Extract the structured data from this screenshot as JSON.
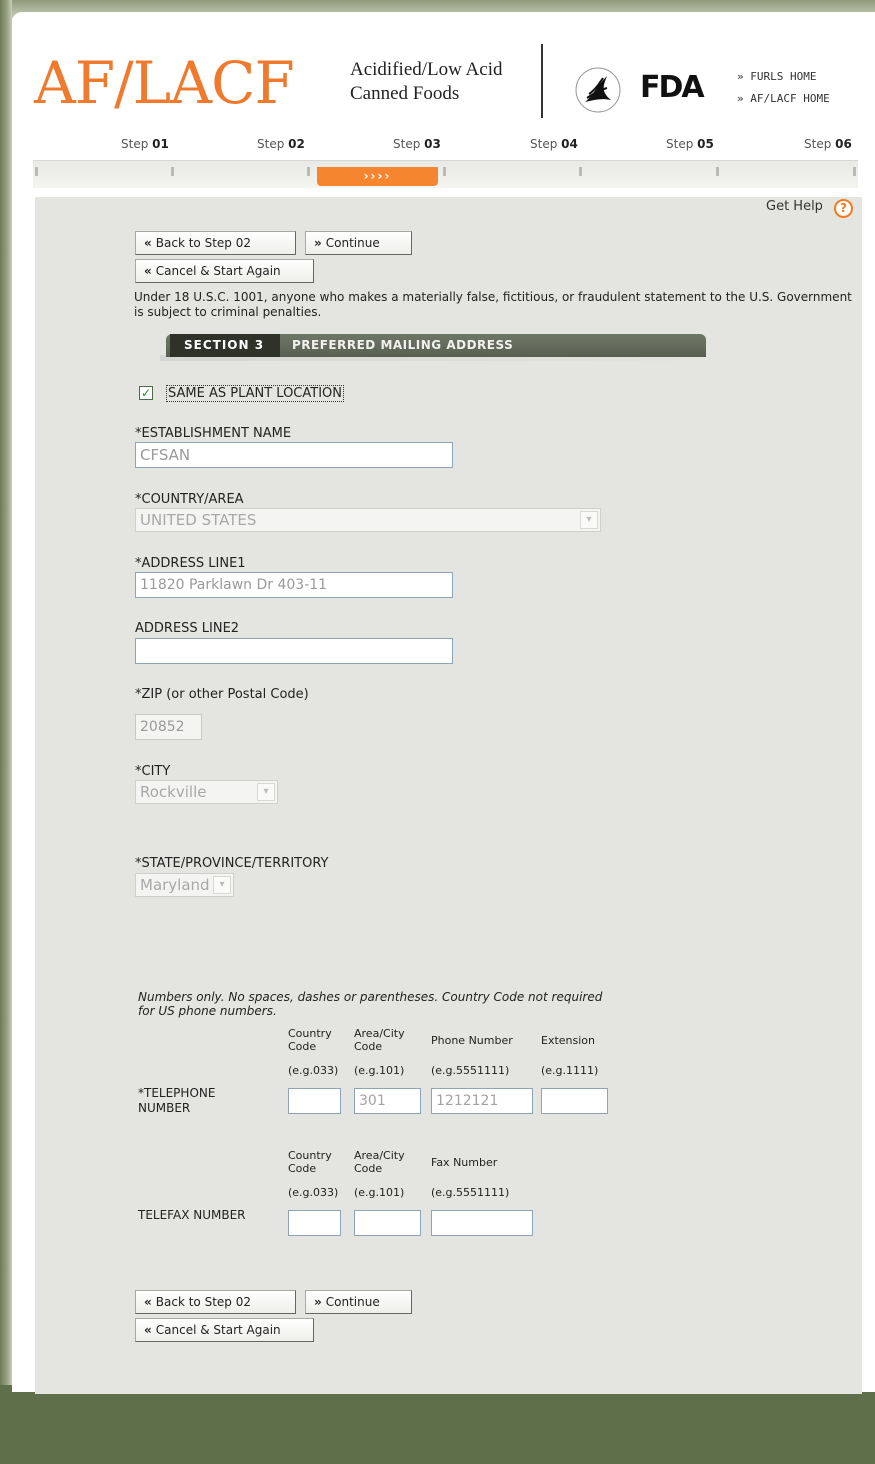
{
  "header": {
    "logo": "AF/LACF",
    "subtitle_line1": "Acidified/Low Acid",
    "subtitle_line2": "Canned Foods",
    "fda": "FDA",
    "links": [
      "» FURLS HOME",
      "» AF/LACF HOME"
    ]
  },
  "steps": [
    {
      "prefix": "Step",
      "num": "01"
    },
    {
      "prefix": "Step",
      "num": "02"
    },
    {
      "prefix": "Step",
      "num": "03"
    },
    {
      "prefix": "Step",
      "num": "04"
    },
    {
      "prefix": "Step",
      "num": "05"
    },
    {
      "prefix": "Step",
      "num": "06"
    }
  ],
  "current_step_marker": "››››",
  "help": {
    "label": "Get Help",
    "icon": "?"
  },
  "nav_top": {
    "back": "Back to Step 02",
    "continue": "Continue",
    "cancel": "Cancel & Start Again"
  },
  "nav_bottom": {
    "back": "Back to Step 02",
    "continue": "Continue",
    "cancel": "Cancel & Start Again"
  },
  "notice": "Under 18 U.S.C. 1001, anyone who makes a materially false, fictitious, or fraudulent statement to the U.S. Government is subject to criminal penalties.",
  "section": {
    "number": "SECTION 3",
    "title": "PREFERRED MAILING ADDRESS"
  },
  "same_as_plant": {
    "label": "SAME AS PLANT LOCATION",
    "checked": true
  },
  "form": {
    "establishment": {
      "label": "*ESTABLISHMENT NAME",
      "value": "CFSAN"
    },
    "country": {
      "label": "*COUNTRY/AREA",
      "value": "UNITED STATES"
    },
    "address1": {
      "label": "*ADDRESS LINE1",
      "value": "11820 Parklawn Dr 403-11"
    },
    "address2": {
      "label": "ADDRESS LINE2",
      "value": ""
    },
    "zip": {
      "label": "*ZIP (or other Postal Code)",
      "value": "20852"
    },
    "city": {
      "label": "*CITY",
      "value": "Rockville"
    },
    "state": {
      "label": "*STATE/PROVINCE/TERRITORY",
      "value": "Maryland"
    }
  },
  "phone": {
    "note": "Numbers only. No spaces, dashes or parentheses. Country Code not required for US phone numbers.",
    "headers": {
      "country": "Country Code",
      "area": "Area/City Code",
      "number": "Phone Number",
      "ext": "Extension"
    },
    "examples": {
      "country": "(e.g.033)",
      "area": "(e.g.101)",
      "number": "(e.g.5551111)",
      "ext": "(e.g.1111)"
    },
    "telephone": {
      "label": "*TELEPHONE NUMBER",
      "country": "",
      "area": "301",
      "number": "1212121",
      "ext": ""
    },
    "fax_headers": {
      "country": "Country Code",
      "area": "Area/City Code",
      "number": "Fax Number"
    },
    "fax_examples": {
      "country": "(e.g.033)",
      "area": "(e.g.101)",
      "number": "(e.g.5551111)"
    },
    "telefax": {
      "label": "TELEFAX NUMBER",
      "country": "",
      "area": "",
      "number": ""
    }
  },
  "colors": {
    "brand_orange": "#ef7a2e",
    "section_bar": "#585f52",
    "panel": "#e4e5e0",
    "frame_green": "#5f6f4a"
  }
}
